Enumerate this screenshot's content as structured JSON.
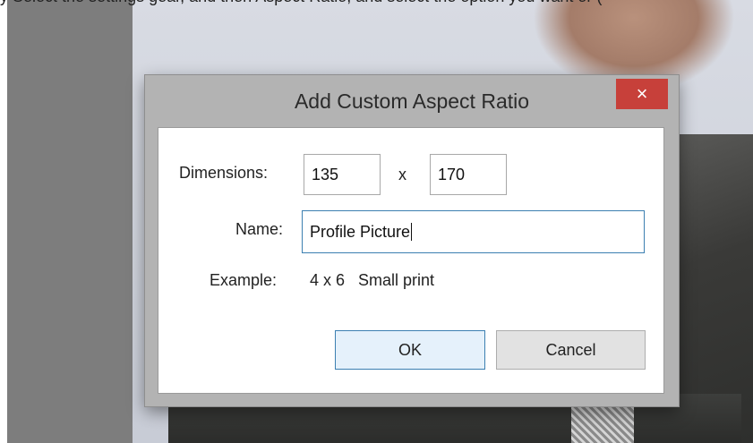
{
  "top_text": "y  Select the settings gear, and then Aspect Ratio, and select the option you want or (",
  "dialog": {
    "title": "Add Custom Aspect Ratio",
    "close_glyph": "×",
    "dimensions_label": "Dimensions:",
    "width_value": "135",
    "times_label": "x",
    "height_value": "170",
    "name_label": "Name:",
    "name_value": "Profile Picture",
    "example_label": "Example:",
    "example_value": "4 x 6   Small print",
    "ok_label": "OK",
    "cancel_label": "Cancel"
  },
  "colors": {
    "close_button": "#c7403a",
    "title_bar": "#b3b3b3",
    "focus_border": "#3c7fb1"
  }
}
